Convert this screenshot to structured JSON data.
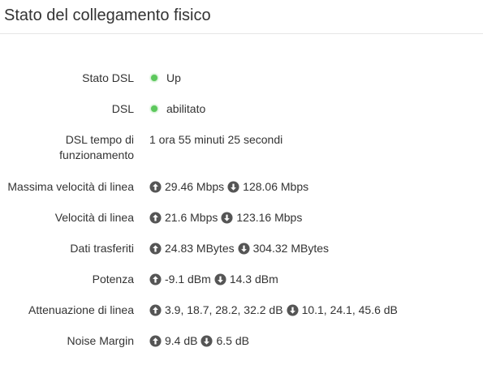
{
  "title": "Stato del collegamento fisico",
  "rows": {
    "stato_dsl": {
      "label": "Stato DSL",
      "value": "Up"
    },
    "dsl": {
      "label": "DSL",
      "value": "abilitato"
    },
    "uptime": {
      "label_line1": "DSL tempo di",
      "label_line2": "funzionamento",
      "value": "1 ora 55 minuti 25 secondi"
    },
    "max_speed": {
      "label": "Massima velocità di linea",
      "up": "29.46 Mbps",
      "down": "128.06 Mbps"
    },
    "speed": {
      "label": "Velocità di linea",
      "up": "21.6 Mbps",
      "down": "123.16 Mbps"
    },
    "data": {
      "label": "Dati trasferiti",
      "up": "24.83 MBytes",
      "down": "304.32 MBytes"
    },
    "power": {
      "label": "Potenza",
      "up": "-9.1 dBm",
      "down": "14.3 dBm"
    },
    "attenuation": {
      "label": "Attenuazione di linea",
      "up": "3.9, 18.7, 28.2, 32.2 dB",
      "down": "10.1, 24.1, 45.6 dB"
    },
    "noise": {
      "label": "Noise Margin",
      "up": "9.4 dB",
      "down": "6.5 dB"
    }
  },
  "colors": {
    "status_led": "#5cc85c",
    "arrow_icon": "#555555"
  },
  "icons": {
    "status": "status-led-icon",
    "upload": "arrow-up-circle-icon",
    "download": "arrow-down-circle-icon"
  }
}
